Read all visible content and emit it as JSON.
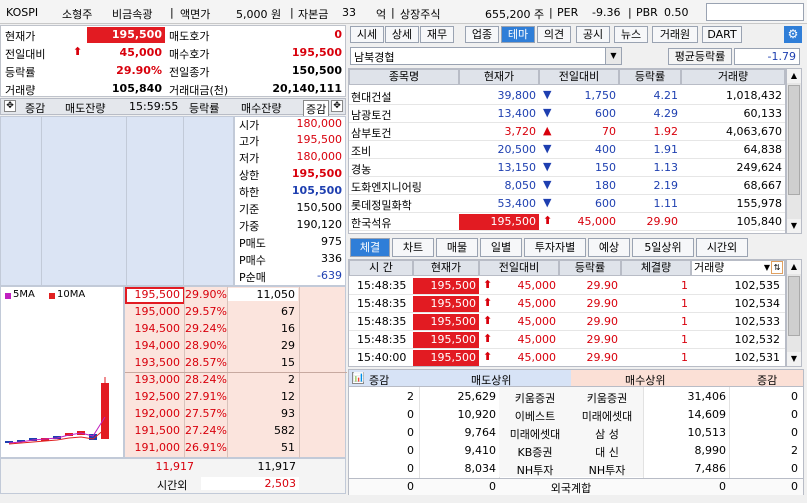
{
  "top": {
    "market": "KOSPI",
    "size": "소형주",
    "sector": "비금속광",
    "face_label": "액면가",
    "face_value": "5,000 원",
    "capital_label": "자본금",
    "capital_value": "33",
    "capital_unit": "억",
    "listed_label": "상장주식",
    "listed_value": "655,200 주",
    "per_label": "PER",
    "per_value": "-9.36",
    "pbr_label": "PBR",
    "pbr_value": "0.50"
  },
  "quote": [
    {
      "label": "현재가",
      "value": "195,500",
      "label2": "매도호가",
      "value2": "0"
    },
    {
      "label": "전일대비",
      "value": "45,000",
      "label2": "매수호가",
      "value2": "195,500"
    },
    {
      "label": "등락률",
      "value": "29.90%",
      "label2": "전일종가",
      "value2": "150,500"
    },
    {
      "label": "거래량",
      "value": "105,840",
      "label2": "거래대금(천)",
      "value2": "20,140,111"
    }
  ],
  "book_header": {
    "chg": "증감",
    "ask_vol": "매도잔량",
    "time": "15:59:55",
    "rate": "등락률",
    "bid_vol": "매수잔량",
    "chg2": "증감"
  },
  "info": [
    {
      "label": "시가",
      "value": "180,000"
    },
    {
      "label": "고가",
      "value": "195,500"
    },
    {
      "label": "저가",
      "value": "180,000"
    },
    {
      "label": "상한",
      "value": "195,500"
    },
    {
      "label": "하한",
      "value": "105,500"
    },
    {
      "label": "기준",
      "value": "150,500"
    },
    {
      "label": "가중",
      "value": "190,120"
    },
    {
      "label": "P매도",
      "value": "975"
    },
    {
      "label": "P매수",
      "value": "336"
    },
    {
      "label": "P순매",
      "value": "-639"
    }
  ],
  "legend": {
    "ma5": "5MA",
    "ma10": "10MA"
  },
  "bids": [
    {
      "price": "195,500",
      "rate": "29.90%",
      "vol": "11,050"
    },
    {
      "price": "195,000",
      "rate": "29.57%",
      "vol": "67"
    },
    {
      "price": "194,500",
      "rate": "29.24%",
      "vol": "16"
    },
    {
      "price": "194,000",
      "rate": "28.90%",
      "vol": "29"
    },
    {
      "price": "193,500",
      "rate": "28.57%",
      "vol": "15"
    },
    {
      "price": "193,000",
      "rate": "28.24%",
      "vol": "2"
    },
    {
      "price": "192,500",
      "rate": "27.91%",
      "vol": "12"
    },
    {
      "price": "192,000",
      "rate": "27.57%",
      "vol": "93"
    },
    {
      "price": "191,500",
      "rate": "27.24%",
      "vol": "582"
    },
    {
      "price": "191,000",
      "rate": "26.91%",
      "vol": "51"
    }
  ],
  "book_total": {
    "ask": "11,917",
    "bid": "11,917",
    "after_label": "시간외",
    "after": "2,503"
  },
  "tabs": [
    "시세",
    "상세",
    "재무",
    "업종",
    "테마",
    "의견",
    "공시",
    "뉴스",
    "거래원",
    "DART"
  ],
  "theme": {
    "name": "남북경협",
    "avg_label": "평균등락률",
    "avg_value": "-1.79"
  },
  "theme_headers": [
    "종목명",
    "현재가",
    "전일대비",
    "등락률",
    "거래량"
  ],
  "theme_rows": [
    {
      "name": "현대건설",
      "price": "39,800",
      "diff": "1,750",
      "dir": "dn",
      "rate": "4.21",
      "vol": "1,018,432"
    },
    {
      "name": "남광토건",
      "price": "13,400",
      "diff": "600",
      "dir": "dn",
      "rate": "4.29",
      "vol": "60,133"
    },
    {
      "name": "삼부토건",
      "price": "3,720",
      "diff": "70",
      "dir": "up",
      "rate": "1.92",
      "vol": "4,063,670"
    },
    {
      "name": "조비",
      "price": "20,500",
      "diff": "400",
      "dir": "dn",
      "rate": "1.91",
      "vol": "64,838"
    },
    {
      "name": "경농",
      "price": "13,150",
      "diff": "150",
      "dir": "dn",
      "rate": "1.13",
      "vol": "249,624"
    },
    {
      "name": "도화엔지니어링",
      "price": "8,050",
      "diff": "180",
      "dir": "dn",
      "rate": "2.19",
      "vol": "68,667"
    },
    {
      "name": "롯데정밀화학",
      "price": "53,400",
      "diff": "600",
      "dir": "dn",
      "rate": "1.11",
      "vol": "155,978"
    },
    {
      "name": "한국석유",
      "price": "195,500",
      "diff": "45,000",
      "dir": "upl",
      "rate": "29.90",
      "vol": "105,840"
    }
  ],
  "tabs2": [
    "체결",
    "차트",
    "매물",
    "일별",
    "투자자별",
    "예상",
    "5일상위",
    "시간외"
  ],
  "trade_headers": [
    "시 간",
    "현재가",
    "전일대비",
    "등락률",
    "체결량",
    "거래량"
  ],
  "trades": [
    {
      "time": "15:48:35",
      "price": "195,500",
      "diff": "45,000",
      "rate": "29.90",
      "qty": "1",
      "vol": "102,535"
    },
    {
      "time": "15:48:35",
      "price": "195,500",
      "diff": "45,000",
      "rate": "29.90",
      "qty": "1",
      "vol": "102,534"
    },
    {
      "time": "15:48:35",
      "price": "195,500",
      "diff": "45,000",
      "rate": "29.90",
      "qty": "1",
      "vol": "102,533"
    },
    {
      "time": "15:48:35",
      "price": "195,500",
      "diff": "45,000",
      "rate": "29.90",
      "qty": "1",
      "vol": "102,532"
    },
    {
      "time": "15:40:00",
      "price": "195,500",
      "diff": "45,000",
      "rate": "29.90",
      "qty": "1",
      "vol": "102,531"
    }
  ],
  "broker_headers": [
    "증감",
    "매도상위",
    "매수상위",
    "증감"
  ],
  "brokers": [
    {
      "chg": "2",
      "sell_vol": "25,629",
      "sell": "키움증권",
      "buy": "키움증권",
      "buy_vol": "31,406",
      "chg2": "0"
    },
    {
      "chg": "0",
      "sell_vol": "10,920",
      "sell": "이베스트",
      "buy": "미래에셋대",
      "buy_vol": "14,609",
      "chg2": "0"
    },
    {
      "chg": "0",
      "sell_vol": "9,764",
      "sell": "미래에셋대",
      "buy": "삼 성",
      "buy_vol": "10,513",
      "chg2": "0"
    },
    {
      "chg": "0",
      "sell_vol": "9,410",
      "sell": "KB증권",
      "buy": "대 신",
      "buy_vol": "8,990",
      "chg2": "2"
    },
    {
      "chg": "0",
      "sell_vol": "8,034",
      "sell": "NH투자",
      "buy": "NH투자",
      "buy_vol": "7,486",
      "chg2": "0"
    }
  ],
  "foreign": {
    "left": "0",
    "left2": "0",
    "label": "외국계합",
    "right": "0",
    "right2": "0"
  }
}
